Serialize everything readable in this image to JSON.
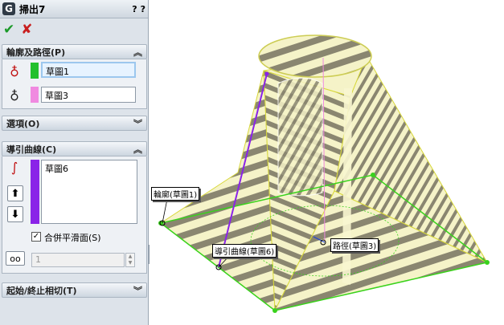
{
  "panel": {
    "title": "掃出7",
    "help": "?",
    "pin": "?",
    "ok_icon": "check-icon",
    "cancel_icon": "close-icon"
  },
  "profile_path": {
    "header": "輪廓及路徑(P)",
    "profile_value": "草圖1",
    "profile_color": "#22c02c",
    "path_value": "草圖3",
    "path_color": "#f08ae0"
  },
  "options": {
    "header": "選項(O)"
  },
  "guide_curves": {
    "header": "導引曲線(C)",
    "color": "#8a23e8",
    "items": [
      "草圖6"
    ],
    "move_up": "⬆",
    "move_down": "⬇",
    "merge_label": "合併平滑面(S)",
    "merge_checked": "✓",
    "count_value": "1"
  },
  "tangency": {
    "header": "起始/終止相切(T)"
  },
  "callouts": {
    "profile": "輪廓(草圖1)",
    "guide": "導引曲線(草圖6)",
    "path": "路徑(草圖3)"
  },
  "colors": {
    "panel_bg": "#dde3ea",
    "zebra_dark": "#8a8670",
    "zebra_light": "#f5f3c8",
    "edge_yellow": "#d8d83a",
    "sketch_green": "#39d21c",
    "guide_purple": "#8a23e8"
  }
}
